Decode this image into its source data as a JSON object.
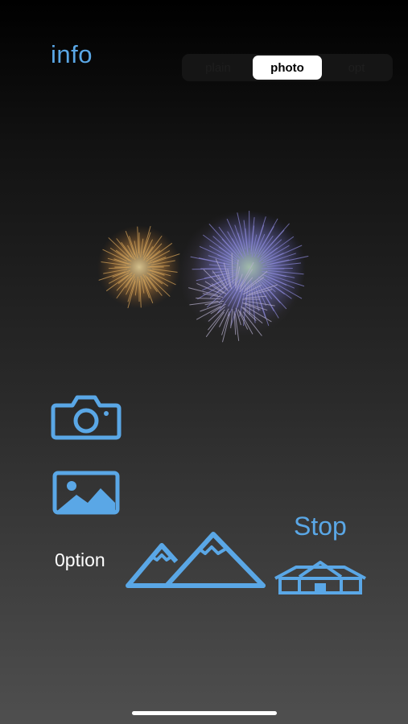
{
  "header": {
    "info_label": "info"
  },
  "segmented_control": {
    "options": [
      "plain",
      "photo",
      "opt"
    ],
    "selected": "photo"
  },
  "preview": {
    "icon": "fireworks-image"
  },
  "actions": {
    "camera_icon": "camera-icon",
    "gallery_icon": "photo-library-icon",
    "option_label": "0ption",
    "mountains_icon": "mountains-icon",
    "stop_label": "Stop",
    "house_icon": "house-icon"
  },
  "colors": {
    "accent": "#5aa7e6",
    "background_top": "#000000",
    "background_bottom": "#4f4f4f"
  }
}
